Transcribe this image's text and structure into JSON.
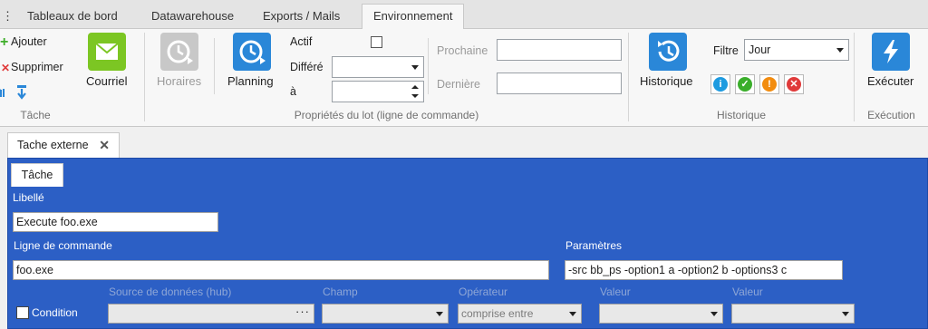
{
  "tabs": [
    {
      "label": "Tableaux de bord"
    },
    {
      "label": "Datawarehouse"
    },
    {
      "label": "Exports / Mails"
    },
    {
      "label": "Environnement"
    }
  ],
  "ribbon": {
    "tache": {
      "ajouter": "Ajouter",
      "supprimer": "Supprimer",
      "courriel": "Courriel",
      "group_label": "Tâche"
    },
    "lot": {
      "horaires": "Horaires",
      "planning": "Planning",
      "actif": "Actif",
      "differe": "Différé",
      "a": "à",
      "prochaine": "Prochaine",
      "derniere": "Dernière",
      "group_label": "Propriétés du lot (ligne de commande)"
    },
    "historique": {
      "button": "Historique",
      "filtre_label": "Filtre",
      "filtre_value": "Jour",
      "group_label": "Historique"
    },
    "execution": {
      "button": "Exécuter",
      "group_label": "Exécution"
    }
  },
  "document_tab": {
    "title": "Tache externe",
    "close": "✕"
  },
  "form": {
    "subtab": "Tâche",
    "libelle_label": "Libellé",
    "libelle_value": "Execute foo.exe",
    "ligne_label": "Ligne de commande",
    "ligne_value": "foo.exe",
    "parametres_label": "Paramètres",
    "parametres_value": "-src bb_ps -option1 a -option2 b -options3 c",
    "condition_label": "Condition",
    "source_label": "Source de données (hub)",
    "champ_label": "Champ",
    "operateur_label": "Opérateur",
    "operateur_value": "comprise entre",
    "valeur1_label": "Valeur",
    "valeur2_label": "Valeur",
    "source_dots": "···"
  },
  "colors": {
    "panel_blue": "#2c5fc5",
    "accent_green": "#7cc623",
    "accent_blue": "#2a87d8",
    "status_info": "#1e9be0",
    "status_ok": "#3aae2a",
    "status_warn": "#f28c0f",
    "status_error": "#e03a3a"
  }
}
